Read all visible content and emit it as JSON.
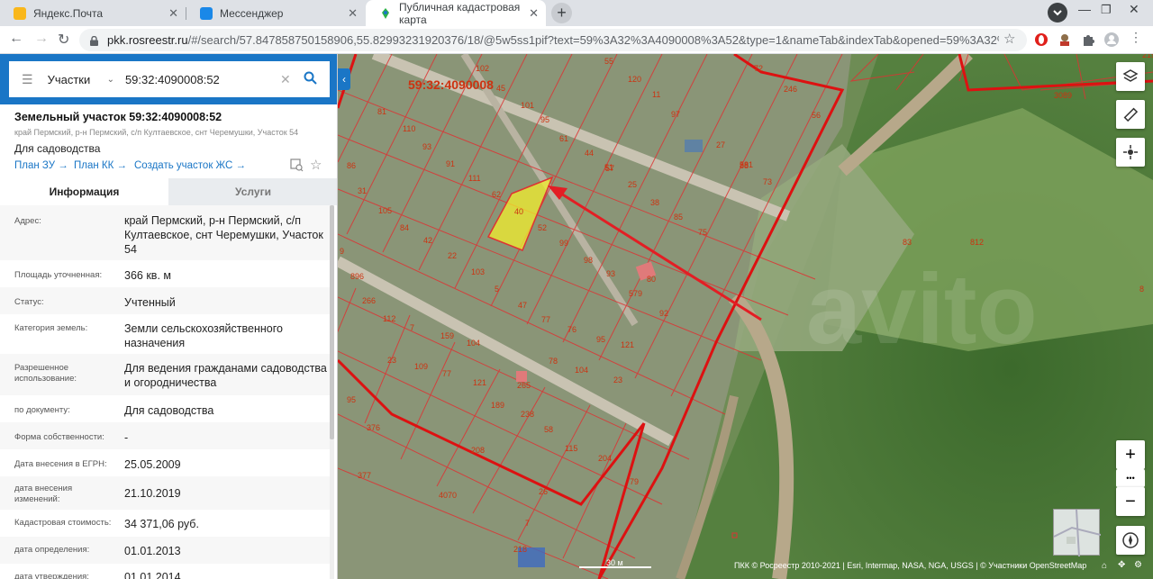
{
  "browser": {
    "tabs": [
      {
        "title": "Яндекс.Почта",
        "favicon_color": "#f9b71b"
      },
      {
        "title": "Мессенджер",
        "favicon_color": "#1a88e8"
      },
      {
        "title": "Публичная кадастровая карта",
        "favicon_color": "#2db34a"
      }
    ],
    "url_host": "pkk.rosreestr.ru",
    "url_path": "/#/search/57.847858750158906,55.82993231920376/18/@5w5ss1pif?text=59%3A32%3A4090008%3A52&type=1&nameTab&indexTab&opened=59%3A32%3A4090008%3A52",
    "new_tab": "+"
  },
  "search": {
    "type_label": "Участки",
    "query": "59:32:4090008:52"
  },
  "parcel": {
    "title": "Земельный участок 59:32:4090008:52",
    "address_short": "край Пермский, р-н Пермский, с/п Култаевское, снт Черемушки, Участок 54",
    "purpose": "Для садоводства",
    "links": [
      "План ЗУ →",
      "План КК →",
      "Создать участок ЖС →"
    ]
  },
  "tabs": {
    "info": "Информация",
    "services": "Услуги"
  },
  "info_rows": [
    {
      "label": "Адрес:",
      "value": "край Пермский, р-н Пермский, с/п Култаевское, снт Черемушки, Участок 54"
    },
    {
      "label": "Площадь уточненная:",
      "value": "366 кв. м"
    },
    {
      "label": "Статус:",
      "value": "Учтенный"
    },
    {
      "label": "Категория земель:",
      "value": "Земли сельскохозяйственного назначения"
    },
    {
      "label": "Разрешенное использование:",
      "value": "Для ведения гражданами садоводства и огородничества"
    },
    {
      "label": "по документу:",
      "value": "Для садоводства"
    },
    {
      "label": "Форма собственности:",
      "value": "-"
    },
    {
      "label": "Дата внесения в ЕГРН:",
      "value": "25.05.2009"
    },
    {
      "label": "дата внесения изменений:",
      "value": "21.10.2019"
    },
    {
      "label": "Кадастровая стоимость:",
      "value": "34 371,06 руб."
    },
    {
      "label": "дата определения:",
      "value": "01.01.2013"
    },
    {
      "label": "дата утверждения:",
      "value": "01.01.2014"
    }
  ],
  "map": {
    "parcel_label": "59:32:4090008",
    "numbers": [
      "102",
      "55",
      "72",
      "246",
      "56",
      "3089",
      "81",
      "110",
      "45",
      "101",
      "95",
      "120",
      "11",
      "97",
      "93",
      "61",
      "57",
      "27",
      "88",
      "73",
      "91",
      "111",
      "44",
      "51",
      "25",
      "581",
      "86",
      "31",
      "105",
      "62",
      "40",
      "52",
      "38",
      "85",
      "84",
      "42",
      "99",
      "22",
      "75",
      "83",
      "812",
      "896",
      "103",
      "98",
      "93",
      "80",
      "266",
      "5",
      "47",
      "579",
      "92",
      "112",
      "7",
      "159",
      "77",
      "76",
      "104",
      "95",
      "121",
      "23",
      "109",
      "77",
      "121",
      "78",
      "104",
      "23",
      "95",
      "189",
      "265",
      "376",
      "238",
      "58",
      "115",
      "377",
      "208",
      "204",
      "79",
      "4070",
      "26",
      "7",
      "218",
      "219",
      "8",
      "896",
      "9"
    ],
    "scale": "30 м",
    "attribution": "ПКК © Росреестр 2010-2021 | Esri, Intermap, NASA, NGA, USGS | © Участники OpenStreetMap",
    "zoom_in": "+",
    "zoom_out": "−",
    "more": "•••"
  }
}
